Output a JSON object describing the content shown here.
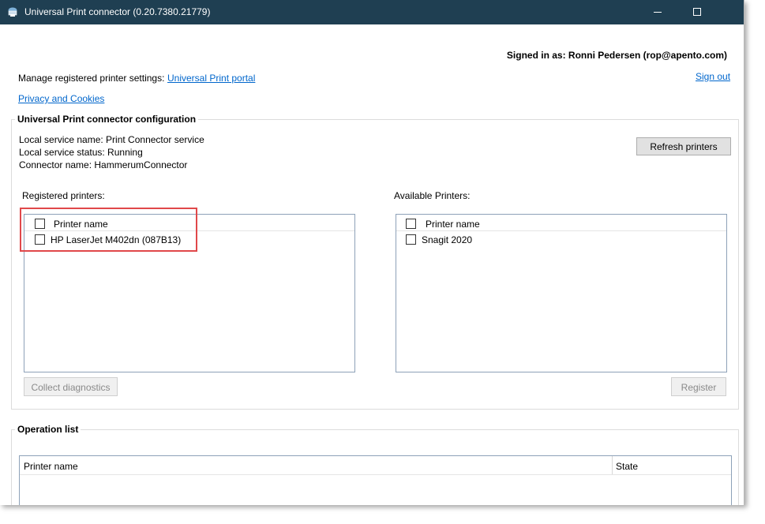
{
  "window": {
    "title": "Universal Print connector (0.20.7380.21779)"
  },
  "header": {
    "signed_in": "Signed in as: Ronni Pedersen (rop@apento.com)",
    "sign_out": "Sign out",
    "manage_label": "Manage registered printer settings:",
    "portal_link": "Universal Print portal",
    "privacy_link": "Privacy and Cookies"
  },
  "config": {
    "group_title": "Universal Print connector configuration",
    "service_name": "Local service name: Print Connector service",
    "service_status": "Local service status: Running",
    "connector_name": "Connector name: HammerumConnector",
    "refresh_button": "Refresh printers"
  },
  "registered": {
    "label": "Registered printers:",
    "column": "Printer name",
    "printers": [
      "HP LaserJet M402dn (087B13)"
    ],
    "collect_button": "Collect diagnostics"
  },
  "available": {
    "label": "Available Printers:",
    "column": "Printer name",
    "printers": [
      "Snagit 2020"
    ],
    "register_button": "Register"
  },
  "operations": {
    "group_title": "Operation list",
    "columns": [
      "Printer name",
      "State"
    ]
  },
  "colors": {
    "titlebar": "#1f3f52",
    "link": "#0066cc",
    "highlight": "#e0484a"
  }
}
